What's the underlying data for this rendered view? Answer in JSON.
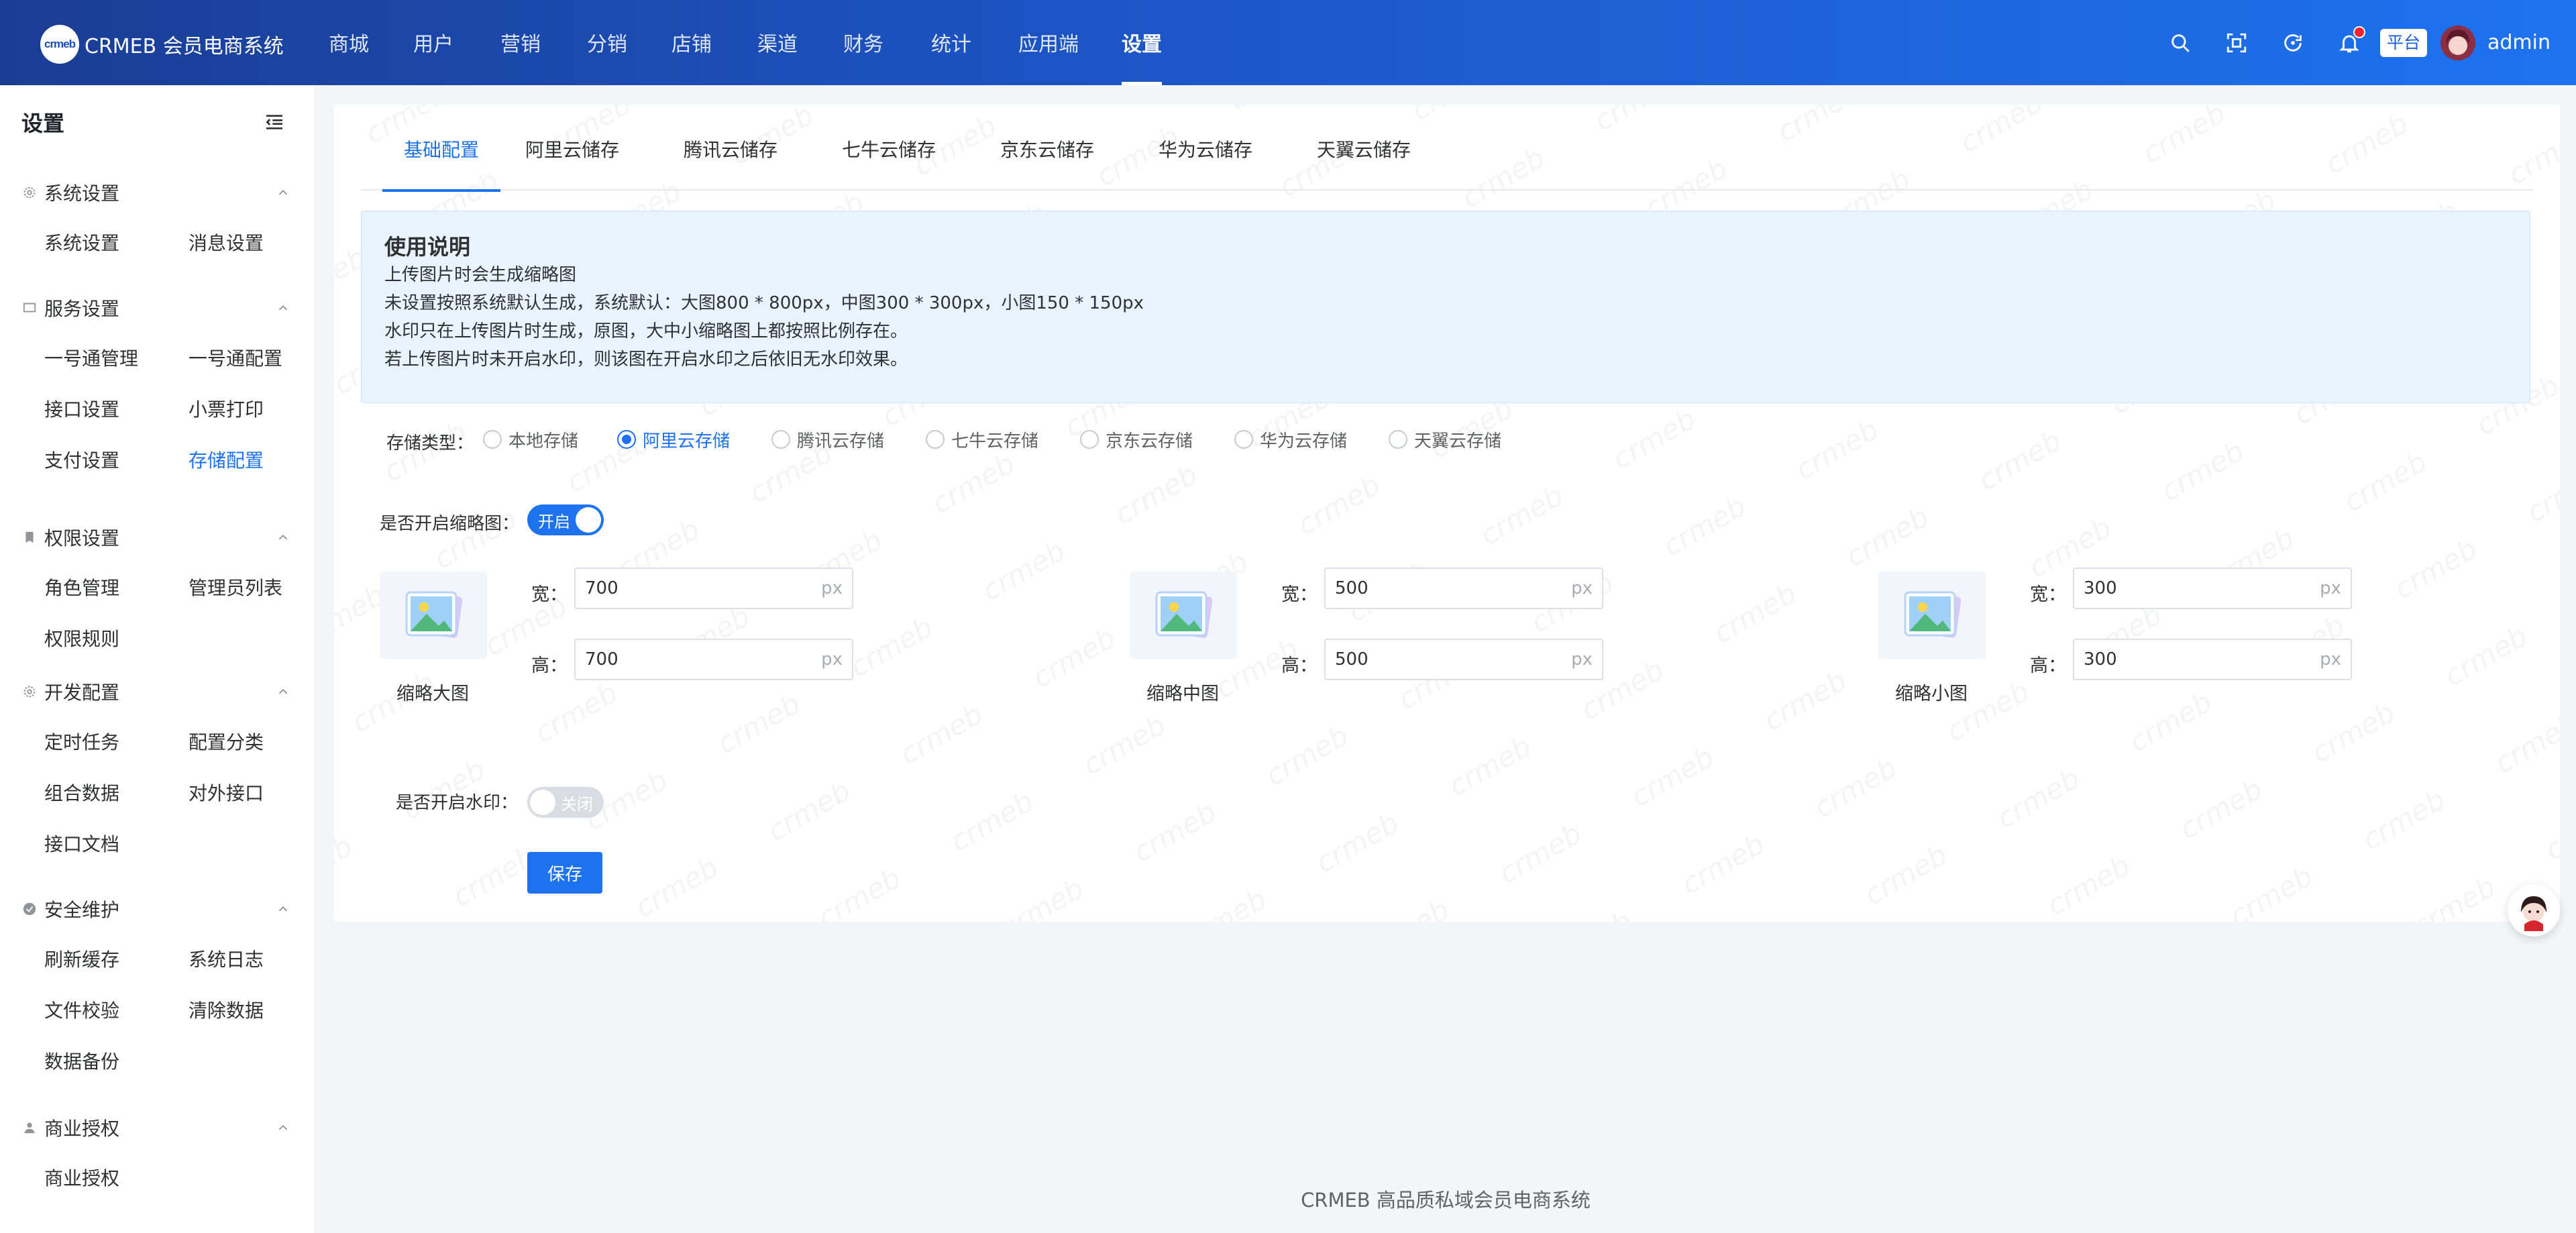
{
  "app": {
    "logo_mark": "crmeb",
    "title": "CRMEB 会员电商系统"
  },
  "topnav": [
    "商城",
    "用户",
    "营销",
    "分销",
    "店铺",
    "渠道",
    "财务",
    "统计",
    "应用端",
    "设置"
  ],
  "topnav_active": "设置",
  "header": {
    "platform_tag": "平台",
    "username": "admin"
  },
  "sidebar": {
    "title": "设置",
    "groups": [
      {
        "label": "系统设置",
        "icon": "gear-icon",
        "items": [
          "系统设置",
          "消息设置"
        ]
      },
      {
        "label": "服务设置",
        "icon": "monitor-icon",
        "items": [
          "一号通管理",
          "一号通配置",
          "接口设置",
          "小票打印",
          "支付设置",
          "存储配置"
        ]
      },
      {
        "label": "权限设置",
        "icon": "bookmark-icon",
        "items": [
          "角色管理",
          "管理员列表",
          "权限规则"
        ]
      },
      {
        "label": "开发配置",
        "icon": "gear-icon",
        "items": [
          "定时任务",
          "配置分类",
          "组合数据",
          "对外接口",
          "接口文档"
        ]
      },
      {
        "label": "安全维护",
        "icon": "check-circle-icon",
        "items": [
          "刷新缓存",
          "系统日志",
          "文件校验",
          "清除数据",
          "数据备份"
        ]
      },
      {
        "label": "商业授权",
        "icon": "user-icon",
        "items": [
          "商业授权"
        ]
      }
    ],
    "active_item": "存储配置"
  },
  "tabs": [
    "基础配置",
    "阿里云储存",
    "腾讯云储存",
    "七牛云储存",
    "京东云储存",
    "华为云储存",
    "天翼云储存"
  ],
  "tabs_active": "基础配置",
  "notice": {
    "title": "使用说明",
    "lines": [
      "上传图片时会生成缩略图",
      "未设置按照系统默认生成，系统默认：大图800 * 800px，中图300 * 300px，小图150 * 150px",
      "水印只在上传图片时生成，原图，大中小缩略图上都按照比例存在。",
      "若上传图片时未开启水印，则该图在开启水印之后依旧无水印效果。"
    ]
  },
  "storage": {
    "label": "存储类型：",
    "options": [
      "本地存储",
      "阿里云存储",
      "腾讯云存储",
      "七牛云存储",
      "京东云存储",
      "华为云存储",
      "天翼云存储"
    ],
    "selected": "阿里云存储"
  },
  "thumbnail": {
    "label": "是否开启缩略图：",
    "switch_on_text": "开启",
    "width_label": "宽：",
    "height_label": "高：",
    "unit": "px",
    "items": [
      {
        "caption": "缩略大图",
        "width": "700",
        "height": "700"
      },
      {
        "caption": "缩略中图",
        "width": "500",
        "height": "500"
      },
      {
        "caption": "缩略小图",
        "width": "300",
        "height": "300"
      }
    ]
  },
  "watermark": {
    "label": "是否开启水印：",
    "switch_off_text": "关闭"
  },
  "actions": {
    "save": "保存"
  },
  "footer": {
    "text": "CRMEB 高品质私域会员电商系统"
  },
  "colors": {
    "primary": "#1d72f0",
    "header_start": "#1a3d94",
    "header_end": "#1e72f0",
    "notice_bg": "#e8f3ff"
  }
}
